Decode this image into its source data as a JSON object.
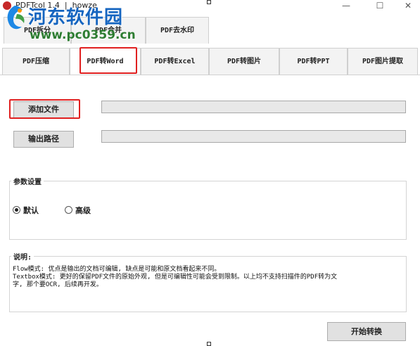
{
  "window": {
    "title": "PDFTcol 1.4  |  howze",
    "minimize_glyph": "—",
    "maximize_glyph": "☐",
    "close_glyph": "✕"
  },
  "watermark": {
    "site_name": "河东软件园",
    "url": "www.pc0359.cn"
  },
  "tabs_row1": [
    {
      "label": "PDF拆分"
    },
    {
      "label": "PDF合并"
    },
    {
      "label": "PDF去水印"
    }
  ],
  "tabs_row2": [
    {
      "label": "PDF压缩"
    },
    {
      "label": "PDF转Word",
      "active": true
    },
    {
      "label": "PDF转Excel"
    },
    {
      "label": "PDF转图片"
    },
    {
      "label": "PDF转PPT"
    },
    {
      "label": "PDF图片提取"
    }
  ],
  "file_section": {
    "add_file_label": "添加文件",
    "output_path_label": "输出路径",
    "file_value": "",
    "output_value": ""
  },
  "params": {
    "group_label": "参数设置",
    "option_default": "默认",
    "option_advanced": "高级",
    "selected": "默认"
  },
  "description": {
    "group_label": "说明:",
    "lines": [
      "Flow模式: 优点是输出的文档可编辑, 缺点是可能和原文档看起来不同。",
      "Textbox模式: 更好的保留PDF文件的原始外观, 但是可编辑性可能会受到限制。以上均不支持扫描件的PDF转为文",
      "字, 那个要OCR, 后续再开发。"
    ]
  },
  "start_button_label": "开始转换",
  "colors": {
    "highlight": "#e02020",
    "watermark_blue": "#1565c0",
    "watermark_green": "#2e7d32",
    "button_bg": "#e1e1e1"
  }
}
